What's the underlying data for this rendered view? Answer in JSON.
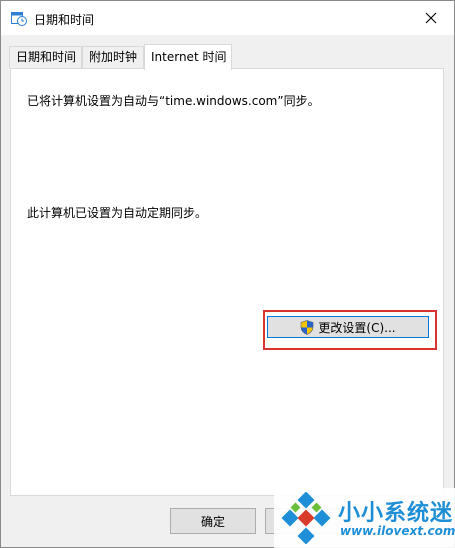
{
  "window": {
    "title": "日期和时间",
    "icons": {
      "app": "clock-calendar-icon",
      "close": "close-icon"
    }
  },
  "tabs": [
    {
      "label": "日期和时间",
      "active": false
    },
    {
      "label": "附加时钟",
      "active": false
    },
    {
      "label": "Internet 时间",
      "active": true
    }
  ],
  "panel": {
    "sync_server_text": "已将计算机设置为自动与“time.windows.com”同步。",
    "auto_sync_text": "此计算机已设置为自动定期同步。",
    "change_settings_label": "更改设置(C)...",
    "change_settings_icon": "uac-shield-icon",
    "highlight_color": "#d9342f"
  },
  "footer": {
    "ok_label": "确定"
  },
  "watermark": {
    "brand": "小小系统迷",
    "url": "www.ilovext.com",
    "color": "#1e8fd6"
  }
}
